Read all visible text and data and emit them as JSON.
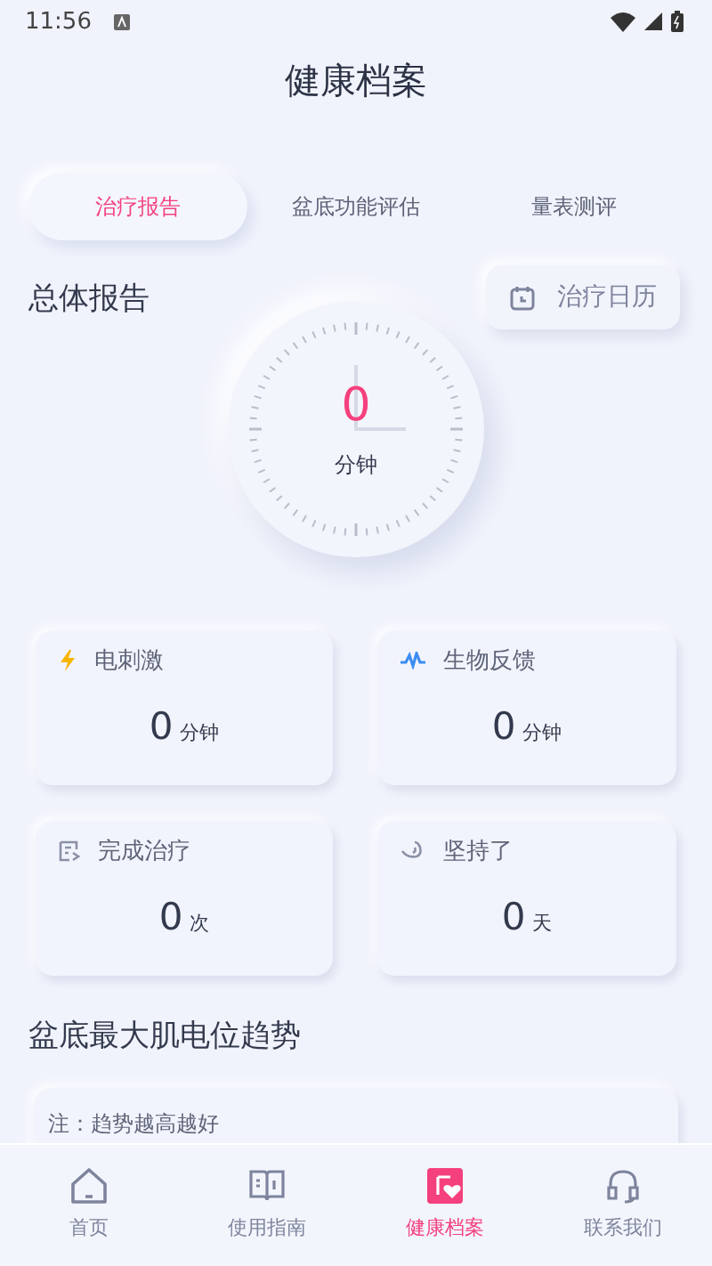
{
  "status_bar": {
    "time": "11:56"
  },
  "title": "健康档案",
  "tabs": [
    {
      "label": "治疗报告",
      "selected": true
    },
    {
      "label": "盆底功能评估",
      "selected": false
    },
    {
      "label": "量表测评",
      "selected": false
    }
  ],
  "overview": {
    "title": "总体报告",
    "calendar_button": "治疗日历",
    "value": "0",
    "unit": "分钟"
  },
  "stats": [
    {
      "kind": "bolt",
      "label": "电刺激",
      "value": "0",
      "unit": "分钟"
    },
    {
      "kind": "wave",
      "label": "生物反馈",
      "value": "0",
      "unit": "分钟"
    },
    {
      "kind": "note",
      "label": "完成治疗",
      "value": "0",
      "unit": "次"
    },
    {
      "kind": "seat",
      "label": "坚持了",
      "value": "0",
      "unit": "天"
    }
  ],
  "trend": {
    "title": "盆底最大肌电位趋势",
    "note": "注：趋势越高越好"
  },
  "nav": [
    {
      "kind": "home",
      "label": "首页",
      "selected": false
    },
    {
      "kind": "book",
      "label": "使用指南",
      "selected": false
    },
    {
      "kind": "record",
      "label": "健康档案",
      "selected": true
    },
    {
      "kind": "headset",
      "label": "联系我们",
      "selected": false
    }
  ]
}
